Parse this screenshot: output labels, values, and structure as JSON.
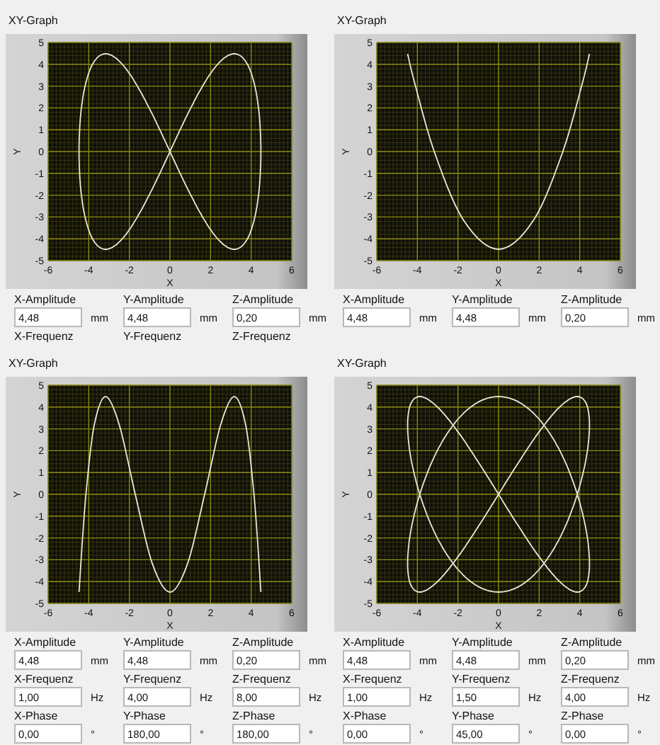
{
  "panels": [
    {
      "title": "XY-Graph",
      "chart_data": {
        "type": "line",
        "xlabel": "X",
        "ylabel": "Y",
        "xlim": [
          -6,
          6
        ],
        "ylim": [
          -5,
          5
        ],
        "xticks": [
          -6,
          -4,
          -2,
          0,
          2,
          4,
          6
        ],
        "yticks": [
          -5,
          -4,
          -3,
          -2,
          -1,
          0,
          1,
          2,
          3,
          4,
          5
        ],
        "grid": true
      },
      "fields": [
        {
          "label": "X-Amplitude",
          "value": "4,48",
          "unit": "mm"
        },
        {
          "label": "Y-Amplitude",
          "value": "4,48",
          "unit": "mm"
        },
        {
          "label": "Z-Amplitude",
          "value": "0,20",
          "unit": "mm"
        },
        {
          "label": "X-Frequenz"
        },
        {
          "label": "Y-Frequenz"
        },
        {
          "label": "Z-Frequenz"
        }
      ]
    },
    {
      "title": "XY-Graph",
      "chart_data": {
        "type": "line",
        "xlabel": "X",
        "ylabel": "Y",
        "xlim": [
          -6,
          6
        ],
        "ylim": [
          -5,
          5
        ],
        "xticks": [
          -6,
          -4,
          -2,
          0,
          2,
          4,
          6
        ],
        "yticks": [
          -5,
          -4,
          -3,
          -2,
          -1,
          0,
          1,
          2,
          3,
          4,
          5
        ],
        "grid": true,
        "x": [
          -4.48,
          -4.14,
          -3.17,
          -1.71,
          0,
          1.71,
          3.17,
          4.14,
          4.48
        ],
        "series": [
          {
            "color": "#ece8d8",
            "values": [
              4.48,
              3.17,
              0,
              -3.17,
              -4.48,
              -3.17,
              0,
              3.17,
              4.48
            ]
          }
        ]
      },
      "fields": [
        {
          "label": "X-Amplitude",
          "value": "4,48",
          "unit": "mm"
        },
        {
          "label": "Y-Amplitude",
          "value": "4,48",
          "unit": "mm"
        },
        {
          "label": "Z-Amplitude",
          "value": "0,20",
          "unit": "mm"
        }
      ]
    },
    {
      "title": "XY-Graph",
      "chart_data": {
        "type": "line",
        "xlabel": "X",
        "ylabel": "Y",
        "xlim": [
          -6,
          6
        ],
        "ylim": [
          -5,
          5
        ],
        "xticks": [
          -6,
          -4,
          -2,
          0,
          2,
          4,
          6
        ],
        "yticks": [
          -5,
          -4,
          -3,
          -2,
          -1,
          0,
          1,
          2,
          3,
          4,
          5
        ],
        "grid": true,
        "x": [
          -4.48,
          -4.39,
          -4.14,
          -3.73,
          -3.17,
          -2.49,
          -1.71,
          -0.87,
          0,
          0.87,
          1.71,
          2.49,
          3.17,
          3.73,
          4.14,
          4.39,
          4.48
        ],
        "series": [
          {
            "color": "#ece8d8",
            "values": [
              -4.48,
              -3.17,
              0,
              3.17,
              4.48,
              3.17,
              0,
              -3.17,
              -4.48,
              -3.17,
              0,
              3.17,
              4.48,
              3.17,
              0,
              -3.17,
              -4.48
            ]
          }
        ]
      },
      "fields": [
        {
          "label": "X-Amplitude",
          "value": "4,48",
          "unit": "mm"
        },
        {
          "label": "Y-Amplitude",
          "value": "4,48",
          "unit": "mm"
        },
        {
          "label": "Z-Amplitude",
          "value": "0,20",
          "unit": "mm"
        },
        {
          "label": "X-Frequenz",
          "value": "1,00",
          "unit": "Hz"
        },
        {
          "label": "Y-Frequenz",
          "value": "4,00",
          "unit": "Hz"
        },
        {
          "label": "Z-Frequenz",
          "value": "8,00",
          "unit": "Hz"
        },
        {
          "label": "X-Phase",
          "value": "0,00",
          "unit": "°"
        },
        {
          "label": "Y-Phase",
          "value": "180,00",
          "unit": "°"
        },
        {
          "label": "Z-Phase",
          "value": "180,00",
          "unit": "°"
        }
      ]
    },
    {
      "title": "XY-Graph",
      "chart_data": {
        "type": "line",
        "xlabel": "X",
        "ylabel": "Y",
        "xlim": [
          -6,
          6
        ],
        "ylim": [
          -5,
          5
        ],
        "xticks": [
          -6,
          -4,
          -2,
          0,
          2,
          4,
          6
        ],
        "yticks": [
          -5,
          -4,
          -3,
          -2,
          -1,
          0,
          1,
          2,
          3,
          4,
          5
        ],
        "grid": true
      },
      "fields": [
        {
          "label": "X-Amplitude",
          "value": "4,48",
          "unit": "mm"
        },
        {
          "label": "Y-Amplitude",
          "value": "4,48",
          "unit": "mm"
        },
        {
          "label": "Z-Amplitude",
          "value": "0,20",
          "unit": "mm"
        },
        {
          "label": "X-Frequenz",
          "value": "1,00",
          "unit": "Hz"
        },
        {
          "label": "Y-Frequenz",
          "value": "1,50",
          "unit": "Hz"
        },
        {
          "label": "Z-Frequenz",
          "value": "4,00",
          "unit": "Hz"
        },
        {
          "label": "X-Phase",
          "value": "0,00",
          "unit": "°"
        },
        {
          "label": "Y-Phase",
          "value": "45,00",
          "unit": "°"
        },
        {
          "label": "Z-Phase",
          "value": "0,00",
          "unit": "°"
        }
      ]
    }
  ]
}
